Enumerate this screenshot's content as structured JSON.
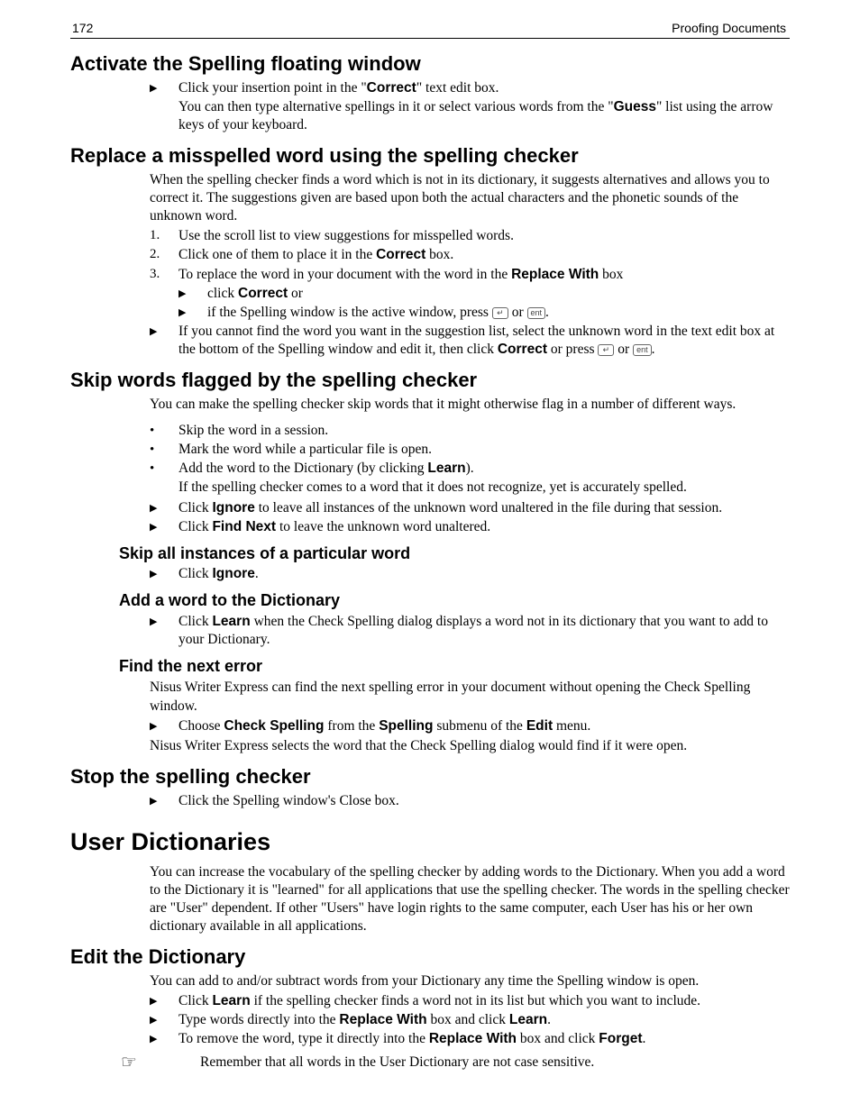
{
  "header": {
    "page_number": "172",
    "running_title": "Proofing Documents"
  },
  "sections": {
    "s1": {
      "title": "Activate the Spelling floating window",
      "bullet1_pre": "Click your insertion point in the \"",
      "bullet1_bold": "Correct",
      "bullet1_post": "\" text edit box.",
      "para1_pre": "You can then type alternative spellings in it or select various words from the \"",
      "para1_bold": "Guess",
      "para1_post": "\" list using the arrow keys of your keyboard."
    },
    "s2": {
      "title": "Replace a misspelled word using the spelling checker",
      "intro": "When the spelling checker finds a word which is not in its dictionary, it suggests alternatives and allows you to correct it. The suggestions given are based upon both the actual characters and the phonetic sounds of the unknown word.",
      "n1": "Use the scroll list to view suggestions for misspelled words.",
      "n2_pre": "Click one of them to place it in the ",
      "n2_bold": "Correct",
      "n2_post": " box.",
      "n3_pre": "To replace the word in your document with the word in the ",
      "n3_bold": "Replace With",
      "n3_post": " box",
      "n3a_pre": "click ",
      "n3a_bold": "Correct",
      "n3a_post": " or",
      "n3b_pre": "if the Spelling window is the active window, press ",
      "n3b_mid": " or ",
      "n3b_post": ".",
      "tri_tail_pre": "If you cannot find the word you want in the suggestion list, select the unknown word in the text edit box at the bottom of the Spelling window and edit it, then click ",
      "tri_tail_bold": "Correct",
      "tri_tail_mid": " or press ",
      "tri_tail_mid2": " or ",
      "tri_tail_post": "."
    },
    "s3": {
      "title": "Skip words flagged by the spelling checker",
      "intro": "You can make the spelling checker skip words that it might otherwise flag in a number of different ways.",
      "d1": "Skip the word in a session.",
      "d2": "Mark the word while a particular file is open.",
      "d3_pre": "Add the word to the Dictionary (by clicking ",
      "d3_bold": "Learn",
      "d3_post": ").",
      "d3_after": "If the spelling checker comes to a word that it does not recognize, yet is accurately spelled.",
      "t1_pre": "Click ",
      "t1_bold": "Ignore",
      "t1_post": " to leave all instances of the unknown word unaltered in the file during that session.",
      "t2_pre": "Click ",
      "t2_bold": "Find Next",
      "t2_post": " to leave the unknown word unaltered.",
      "sub1_title": "Skip all instances of a particular word",
      "sub1_b_pre": "Click ",
      "sub1_b_bold": "Ignore",
      "sub1_b_post": ".",
      "sub2_title": "Add a word to the Dictionary",
      "sub2_b_pre": "Click ",
      "sub2_b_bold": "Learn",
      "sub2_b_post": " when the Check Spelling dialog displays a word not in its dictionary that you want to add to your Dictionary.",
      "sub3_title": "Find the next error",
      "sub3_intro": "Nisus Writer Express can find the next spelling error in your document without opening the Check Spelling window.",
      "sub3_b_pre": "Choose ",
      "sub3_b_b1": "Check Spelling",
      "sub3_b_mid1": " from the ",
      "sub3_b_b2": "Spelling",
      "sub3_b_mid2": " submenu of the ",
      "sub3_b_b3": "Edit",
      "sub3_b_post": " menu.",
      "sub3_after": "Nisus Writer Express selects the word that the Check Spelling dialog would find if it were open."
    },
    "s4": {
      "title": "Stop the spelling checker",
      "b1": "Click the Spelling window's Close box."
    },
    "s5": {
      "title": "User Dictionaries",
      "intro": "You can increase the vocabulary of the spelling checker by adding words to the Dictionary. When you add a word to the Dictionary it is \"learned\" for all applications that use the spelling checker. The words in the spelling checker are \"User\" dependent. If other \"Users\" have login rights to the same computer, each User has his or her own dictionary available in all applications."
    },
    "s6": {
      "title": "Edit the Dictionary",
      "intro": "You can add to and/or subtract words from your Dictionary any time the Spelling window is open.",
      "t1_pre": "Click ",
      "t1_bold": "Learn",
      "t1_post": " if the spelling checker finds a word not in its list but which you want to include.",
      "t2_pre": "Type words directly into the ",
      "t2_bold": "Replace With",
      "t2_mid": " box and click ",
      "t2_bold2": "Learn",
      "t2_post": ".",
      "t3_pre": "To remove the word, type it directly into the ",
      "t3_bold": "Replace With",
      "t3_mid": " box and click ",
      "t3_bold2": "Forget",
      "t3_post": ".",
      "note": "Remember that all words in the User Dictionary are not case sensitive."
    }
  },
  "keys": {
    "return": "↵",
    "enter": "ent"
  }
}
